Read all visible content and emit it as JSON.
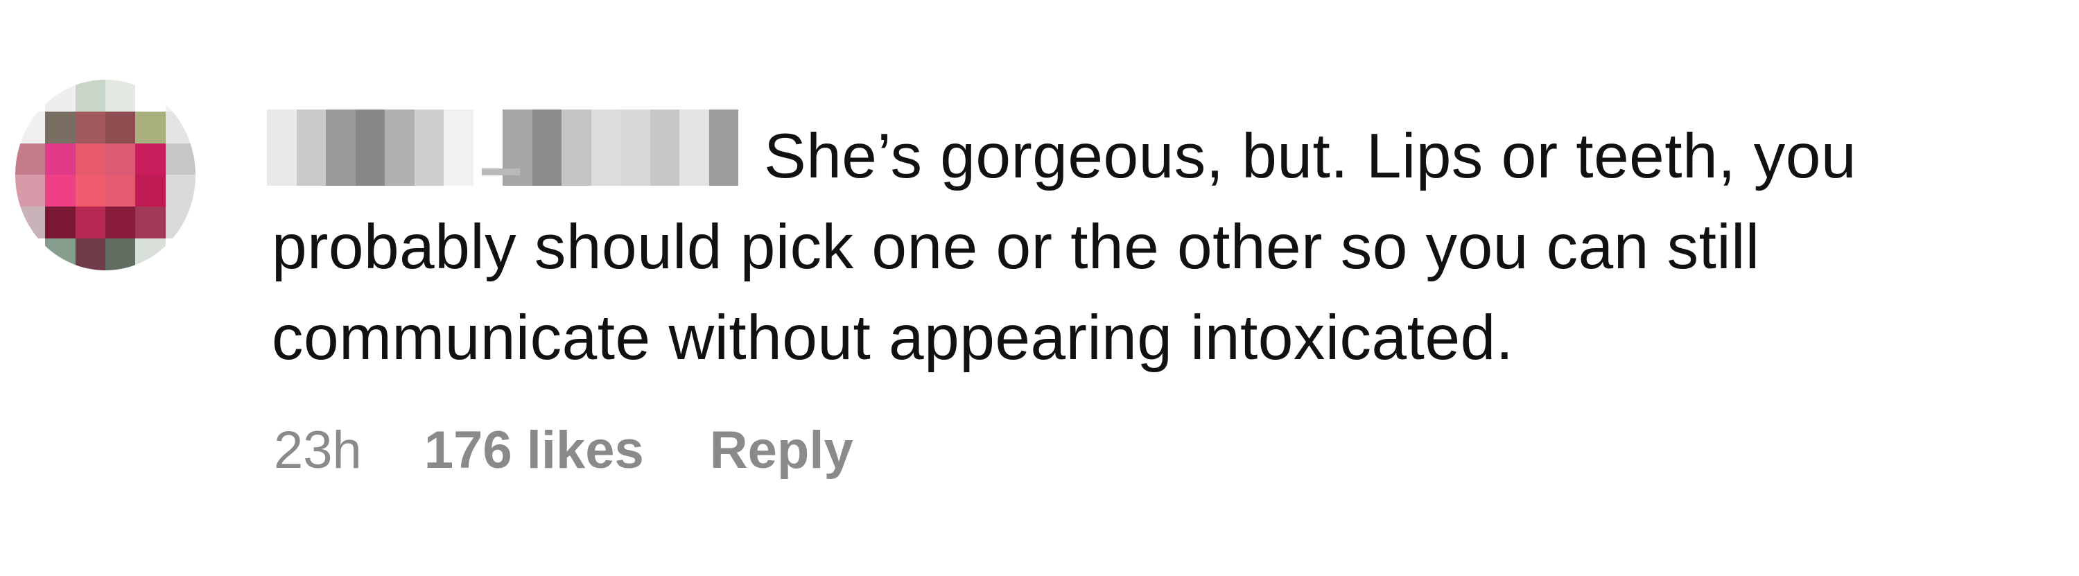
{
  "comment": {
    "username": "redacted_user",
    "text": "She’s gorgeous, but. Lips or teeth, you probably should pick one or the other so you can still communicate without appearing intoxicated.",
    "time": "23h",
    "likes": "176 likes",
    "reply_label": "Reply"
  },
  "avatar_pixels": [
    "#ffffff",
    "#eeeeee",
    "#c7d6c8",
    "#e3e8e0",
    "#ffffff",
    "#f2f2f2",
    "#f0f0f0",
    "#7a6d62",
    "#a35a5e",
    "#8e4d50",
    "#a9b07d",
    "#e4e4e4",
    "#c37b8b",
    "#e13a88",
    "#e75a6d",
    "#dd5a74",
    "#c81c5b",
    "#c6c6c6",
    "#d79aa8",
    "#ef3f85",
    "#f05b6d",
    "#e45a70",
    "#c01a55",
    "#dadada",
    "#c9b3b8",
    "#7a1732",
    "#b72852",
    "#8a1c3b",
    "#a03a56",
    "#d9d9d9",
    "#ffffff",
    "#869e8d",
    "#6f3c4a",
    "#5f6e60",
    "#d9dfd9",
    "#ffffff"
  ],
  "username_blocks": [
    "#e9e9e9",
    "#c9c9c9",
    "#9a9a9a",
    "#888888",
    "#b0b0b0",
    "#cfcfcf",
    "#f1f1f1",
    "#ffffff",
    "#a6a6a6",
    "#8c8c8c",
    "#c4c4c4",
    "#dcdcdc",
    "#d8d8d8",
    "#c7c7c7",
    "#e3e3e3",
    "#9c9c9c"
  ]
}
